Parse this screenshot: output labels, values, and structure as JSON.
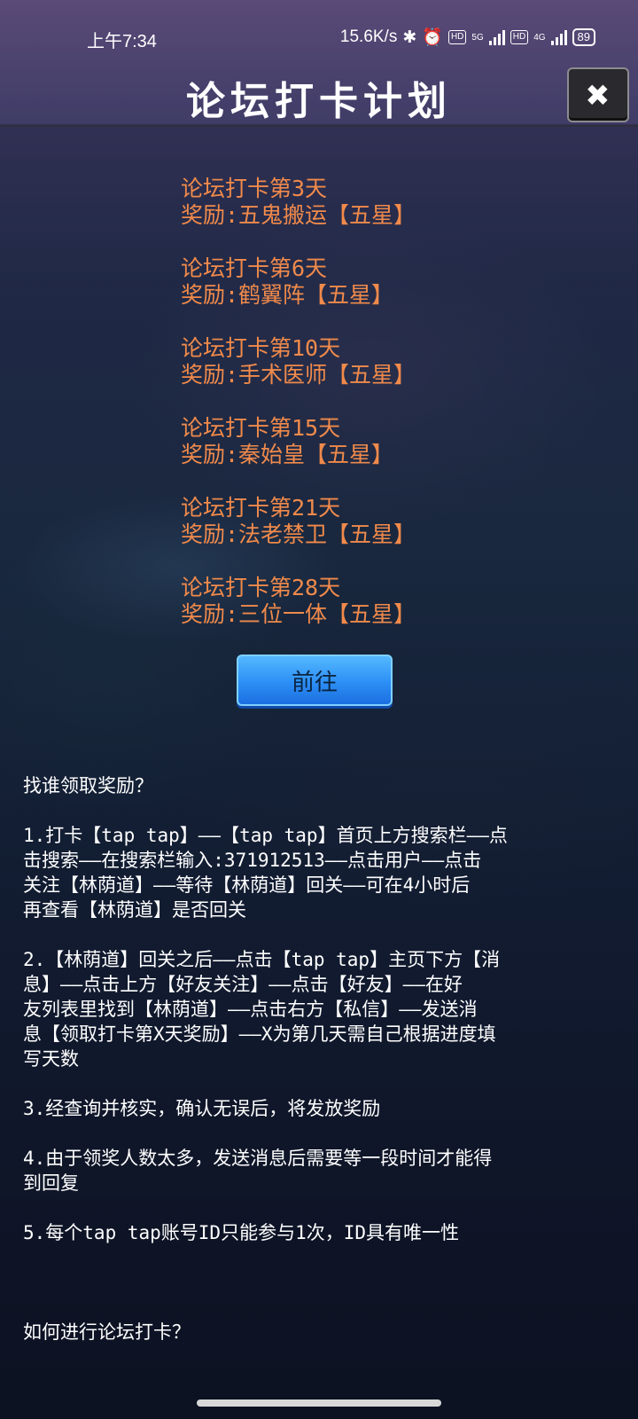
{
  "status_bar": {
    "time": "上午7:34",
    "speed": "15.6K/s",
    "bluetooth": "✱",
    "alarm": "⏰",
    "hd1": "HD",
    "net1": "5G",
    "hd2": "HD",
    "net2": "4G",
    "battery": "89"
  },
  "header": {
    "title": "论坛打卡计划",
    "close": "✖"
  },
  "rewards": [
    {
      "day": "论坛打卡第3天",
      "reward": "奖励:五鬼搬运【五星】"
    },
    {
      "day": "论坛打卡第6天",
      "reward": "奖励:鹤翼阵【五星】"
    },
    {
      "day": "论坛打卡第10天",
      "reward": "奖励:手术医师【五星】"
    },
    {
      "day": "论坛打卡第15天",
      "reward": "奖励:秦始皇【五星】"
    },
    {
      "day": "论坛打卡第21天",
      "reward": "奖励:法老禁卫【五星】"
    },
    {
      "day": "论坛打卡第28天",
      "reward": "奖励:三位一体【五星】"
    }
  ],
  "go_button": "前往",
  "instructions": {
    "heading": "找谁领取奖励？",
    "step1": [
      "1.打卡【tap tap】——【tap tap】首页上方搜索栏——点",
      "击搜索——在搜索栏输入:371912513——点击用户——点击",
      "关注【林荫道】——等待【林荫道】回关——可在4小时后",
      "再查看【林荫道】是否回关"
    ],
    "step2": [
      "2.【林荫道】回关之后——点击【tap tap】主页下方【消",
      "息】——点击上方【好友关注】——点击【好友】——在好",
      "友列表里找到【林荫道】——点击右方【私信】——发送消",
      "息【领取打卡第X天奖励】——X为第几天需自己根据进度填",
      "写天数"
    ],
    "step3": "3.经查询并核实，确认无误后，将发放奖励",
    "step4": [
      "4.由于领奖人数太多，发送消息后需要等一段时间才能得",
      "到回复"
    ],
    "step5": "5.每个tap tap账号ID只能参与1次，ID具有唯一性",
    "footer": "如何进行论坛打卡？"
  }
}
